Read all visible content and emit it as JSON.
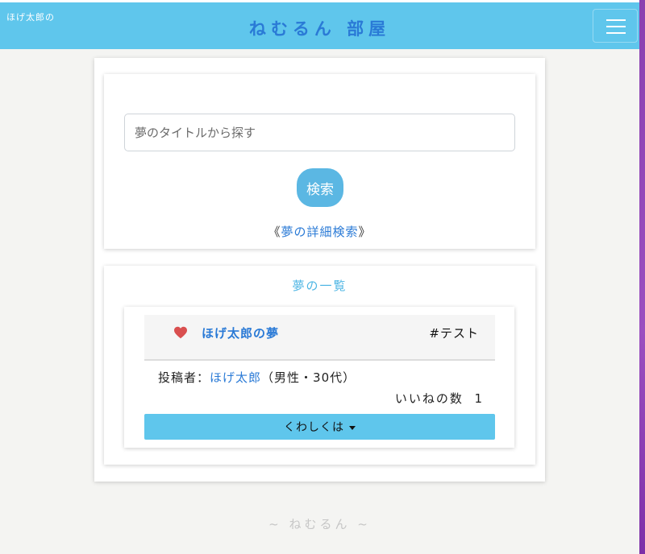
{
  "header": {
    "brand": "ほげ太郎の",
    "title": "ねむるん 部屋",
    "colors": {
      "bar": "#5fc6ec",
      "title": "#2a7ad6"
    }
  },
  "search": {
    "placeholder": "夢のタイトルから探す",
    "button_label": "検索",
    "advanced_prefix": "《",
    "advanced_link": "夢の詳細検索",
    "advanced_suffix": "》"
  },
  "dream_list": {
    "heading": "夢の一覧",
    "items": [
      {
        "title": "ほげ太郎の夢",
        "tag": "#テスト",
        "poster_label": "投稿者：",
        "poster_name": "ほげ太郎",
        "poster_info": "（男性・30代）",
        "likes_label": "いいねの数",
        "likes_count": "1",
        "details_label": "くわしくは",
        "icon": "heart-icon"
      }
    ]
  },
  "footer": {
    "text": "~ ねむるん ~"
  }
}
